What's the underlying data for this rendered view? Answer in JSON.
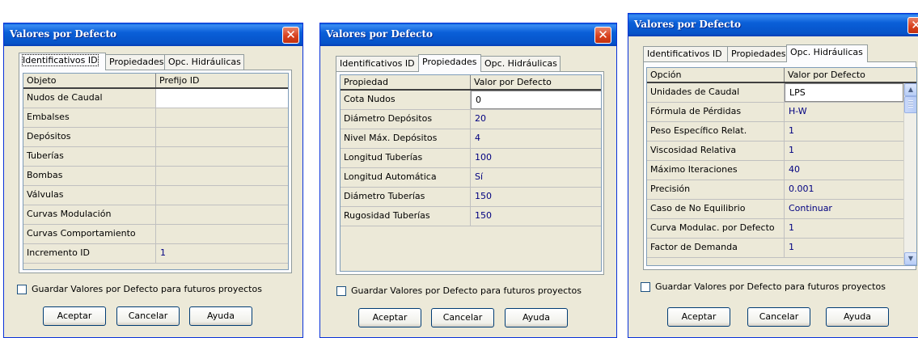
{
  "dialogs": [
    {
      "title": "Valores por Defecto",
      "close_glyph": "✕",
      "tabs": [
        "Identificativos ID",
        "Propiedades",
        "Opc. Hidráulicas"
      ],
      "active_tab": 0,
      "grid": {
        "headers": [
          "Objeto",
          "Prefijo ID"
        ],
        "rows": [
          [
            "Nudos de Caudal",
            ""
          ],
          [
            "Embalses",
            ""
          ],
          [
            "Depósitos",
            ""
          ],
          [
            "Tuberías",
            ""
          ],
          [
            "Bombas",
            ""
          ],
          [
            "Válvulas",
            ""
          ],
          [
            "Curvas Modulación",
            ""
          ],
          [
            "Curvas Comportamiento",
            ""
          ],
          [
            "Incremento ID",
            "1"
          ]
        ]
      },
      "checkbox_label": "Guardar Valores por Defecto para futuros proyectos",
      "buttons": {
        "ok": "Aceptar",
        "cancel": "Cancelar",
        "help": "Ayuda"
      }
    },
    {
      "title": "Valores por Defecto",
      "close_glyph": "✕",
      "tabs": [
        "Identificativos ID",
        "Propiedades",
        "Opc. Hidráulicas"
      ],
      "active_tab": 1,
      "grid": {
        "headers": [
          "Propiedad",
          "Valor por Defecto"
        ],
        "rows": [
          [
            "Cota Nudos",
            "0"
          ],
          [
            "Diámetro Depósitos",
            "20"
          ],
          [
            "Nivel Máx. Depósitos",
            "4"
          ],
          [
            "Longitud Tuberías",
            "100"
          ],
          [
            "Longitud Automática",
            "Sí"
          ],
          [
            "Diámetro Tuberías",
            "150"
          ],
          [
            "Rugosidad Tuberías",
            "150"
          ]
        ]
      },
      "checkbox_label": "Guardar Valores por Defecto para futuros proyectos",
      "buttons": {
        "ok": "Aceptar",
        "cancel": "Cancelar",
        "help": "Ayuda"
      }
    },
    {
      "title": "Valores por Defecto",
      "close_glyph": "✕",
      "tabs": [
        "Identificativos ID",
        "Propiedades",
        "Opc. Hidráulicas"
      ],
      "active_tab": 2,
      "grid": {
        "headers": [
          "Opción",
          "Valor por Defecto"
        ],
        "rows": [
          [
            "Unidades de Caudal",
            "LPS"
          ],
          [
            "Fórmula de Pérdidas",
            "H-W"
          ],
          [
            "Peso Específico Relat.",
            "1"
          ],
          [
            "Viscosidad Relativa",
            "1"
          ],
          [
            "Máximo Iteraciones",
            "40"
          ],
          [
            "Precisión",
            "0.001"
          ],
          [
            "Caso de No Equilibrio",
            "Continuar"
          ],
          [
            "Curva Modulac. por Defecto",
            "1"
          ],
          [
            "Factor de Demanda",
            "1"
          ]
        ]
      },
      "checkbox_label": "Guardar Valores por Defecto para futuros proyectos",
      "buttons": {
        "ok": "Aceptar",
        "cancel": "Cancelar",
        "help": "Ayuda"
      }
    }
  ],
  "colors": {
    "titlebar": "#0a5fd8",
    "value_text": "#000080",
    "dialog_bg": "#ece9d8"
  },
  "icons": [
    "close-icon",
    "scroll-up-icon",
    "scroll-down-icon",
    "checkbox-icon"
  ]
}
